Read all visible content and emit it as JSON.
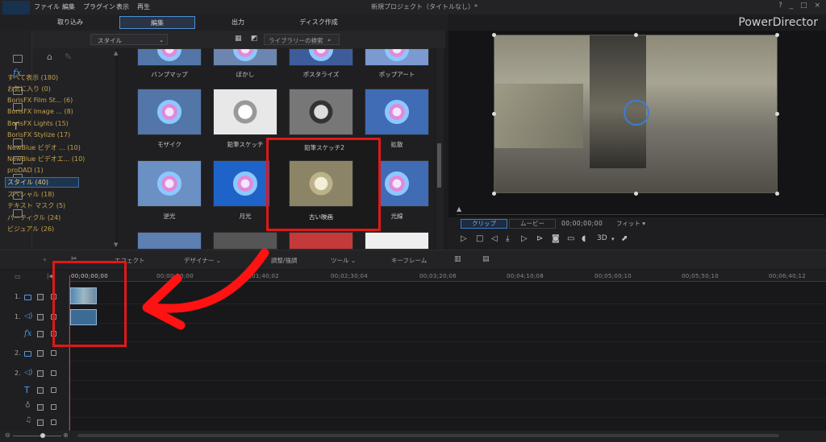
{
  "menu": [
    "ファイル",
    "編集",
    "プラグイン",
    "表示",
    "再生"
  ],
  "window_title": "新規プロジェクト（タイトルなし）*",
  "window_controls": "? _ □ ×",
  "modes": {
    "capture": "取り込み",
    "edit": "編集",
    "output": "出力",
    "disc": "ディスク作成"
  },
  "brand": "PowerDirector",
  "library": {
    "style_dropdown": "スタイル",
    "search_placeholder": "ライブラリーの検索"
  },
  "categories": [
    "すべて表示 (180)",
    "お気に入り (0)",
    "BorisFX Film St... (6)",
    "BorisFX Image ... (8)",
    "BorisFX Lights (15)",
    "BorisFX Stylize (17)",
    "NewBlue ビデオ ... (10)",
    "NewBlue ビデオエ... (10)",
    "proDAD (1)",
    "スタイル (40)",
    "スペシャル (18)",
    "テキスト マスク (5)",
    "パーティクル (24)",
    "ビジュアル (26)"
  ],
  "selected_category_index": 9,
  "thumbs_row0": [
    "バンプマップ",
    "ぼかし",
    "ポスタライズ",
    "ポップアート"
  ],
  "thumbs_row1": [
    "モザイク",
    "鉛筆スケッチ",
    "",
    "拡散"
  ],
  "thumbs_row2": [
    "逆光",
    "月光",
    "古い映画",
    "光線"
  ],
  "tooltip_label": "鉛筆スケッチ2",
  "preview": {
    "clip_tab": "クリップ",
    "movie_tab": "ムービー",
    "timecode": "00;00;00;00",
    "fit": "フィット",
    "mode_3d": "3D"
  },
  "timeline_toolbar": [
    "エフェクト",
    "デザイナー",
    "調整/強調",
    "ツール",
    "キーフレーム"
  ],
  "ruler_ticks": [
    "00;00;00;00",
    "00;00;50;00",
    "00;01;40;02",
    "00;02;30;04",
    "00;03;20;06",
    "00;04;10;08",
    "00;05;00;10",
    "00;05;50;10",
    "00;06;40;12"
  ],
  "track_numbers": [
    "1.",
    "1.",
    "",
    "2.",
    "2.",
    "",
    "",
    ""
  ]
}
